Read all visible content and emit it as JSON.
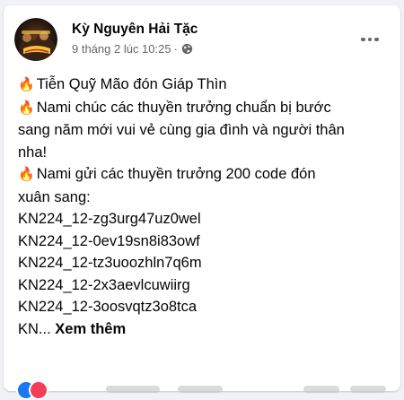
{
  "post": {
    "author": "Kỳ Nguyên Hải Tặc",
    "timestamp": "9 tháng 2 lúc 10:25",
    "separator": "·",
    "lines": [
      "Tiễn Quỹ Mão đón Giáp Thìn",
      "Nami chúc các thuyền trưởng chuẩn bị bước",
      "sang năm mới vui vẻ cùng gia đình và người thân",
      "nha!",
      "Nami gửi các thuyền trưởng 200 code đón",
      "xuân sang:",
      "KN224_12-zg3urg47uz0wel",
      "KN224_12-0ev19sn8i83owf",
      "KN224_12-tz3uoozhln7q6m",
      "KN224_12-2x3aevlcuwiirg",
      "KN224_12-3oosvqtz3o8tca"
    ],
    "fire_emoji": "🔥",
    "truncated_prefix": "KN...",
    "see_more": "Xem thêm"
  },
  "icons": {
    "avatar": "page-avatar",
    "audience": "globe-icon",
    "menu": "more-horizontal-icon",
    "fire": "fire-emoji"
  },
  "colors": {
    "text_primary": "#050505",
    "text_secondary": "#65676b",
    "background": "#f0f2f5",
    "card": "#ffffff",
    "like_blue": "#1877f2",
    "love_red": "#f33e58"
  }
}
